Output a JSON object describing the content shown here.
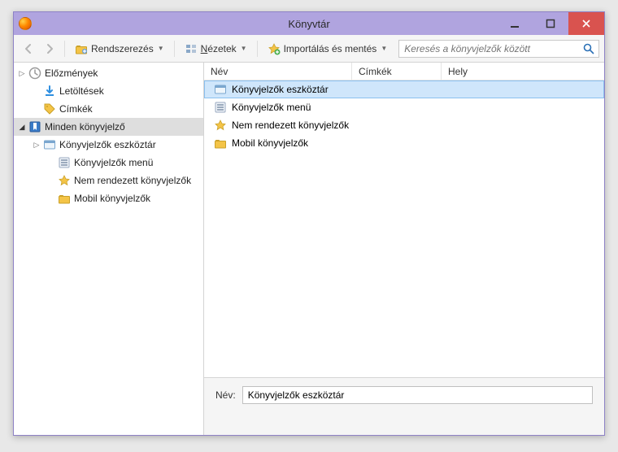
{
  "window": {
    "title": "Könyvtár"
  },
  "toolbar": {
    "organize": "Rendszerezés",
    "views": "Nézetek",
    "views_underline": "N",
    "import": "Importálás és mentés",
    "search_placeholder": "Keresés a könyvjelzők között"
  },
  "tree": {
    "items": [
      {
        "label": "Előzmények",
        "icon": "history",
        "indent": 0,
        "expander": "right"
      },
      {
        "label": "Letöltések",
        "icon": "download",
        "indent": 1,
        "expander": "none"
      },
      {
        "label": "Címkék",
        "icon": "tags",
        "indent": 1,
        "expander": "none"
      },
      {
        "label": "Minden könyvjelző",
        "icon": "allbm",
        "indent": 0,
        "expander": "down",
        "selected": true
      },
      {
        "label": "Könyvjelzők eszköztár",
        "icon": "bmtoolbar",
        "indent": 1,
        "expander": "right"
      },
      {
        "label": "Könyvjelzők menü",
        "icon": "bmmenu",
        "indent": 2,
        "expander": "none"
      },
      {
        "label": "Nem rendezett könyvjelzők",
        "icon": "unsorted",
        "indent": 2,
        "expander": "none"
      },
      {
        "label": "Mobil könyvjelzők",
        "icon": "mobile",
        "indent": 2,
        "expander": "none"
      }
    ]
  },
  "columns": {
    "name": "Név",
    "tags": "Címkék",
    "location": "Hely"
  },
  "list": {
    "rows": [
      {
        "label": "Könyvjelzők eszköztár",
        "icon": "bmtoolbar",
        "selected": true
      },
      {
        "label": "Könyvjelzők menü",
        "icon": "bmmenu"
      },
      {
        "label": "Nem rendezett könyvjelzők",
        "icon": "unsorted"
      },
      {
        "label": "Mobil könyvjelzők",
        "icon": "mobile"
      }
    ]
  },
  "detail": {
    "name_label": "Név:",
    "name_value": "Könyvjelzők eszköztár"
  }
}
